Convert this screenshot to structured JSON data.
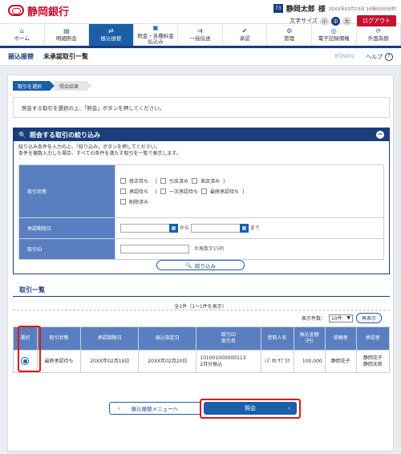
{
  "header": {
    "bank_name": "静岡銀行",
    "user_icon_text": "73",
    "user_name": "静岡太郎",
    "honorific": "様",
    "login_time": "20XX年02月13日 10時00分00秒",
    "font_size_label": "文字サイズ",
    "font_sizes": [
      "小",
      "中",
      "大"
    ],
    "logout": "ログアウト"
  },
  "nav": [
    {
      "icon": "home-icon",
      "glyph": "⌂",
      "label": "ホーム"
    },
    {
      "icon": "statement-icon",
      "glyph": "▤",
      "label": "明細照会"
    },
    {
      "icon": "transfer-icon",
      "glyph": "⇄",
      "label": "振込振替"
    },
    {
      "icon": "tax-icon",
      "glyph": "▣",
      "label": "税金・各種料金\n払込み"
    },
    {
      "icon": "bulk-icon",
      "glyph": "⇉",
      "label": "一括伝送"
    },
    {
      "icon": "approval-icon",
      "glyph": "✔",
      "label": "承認"
    },
    {
      "icon": "manage-icon",
      "glyph": "⚙",
      "label": "管理"
    },
    {
      "icon": "erecord-icon",
      "glyph": "◎",
      "label": "電子記録債権"
    },
    {
      "icon": "forex-icon",
      "glyph": "⟳",
      "label": "外国為替"
    }
  ],
  "title": {
    "main": "振込振替",
    "sub": "未承認取引一覧",
    "screen_id": "BTJS002",
    "help": "ヘルプ"
  },
  "steps": [
    "取引を選択",
    "照会結果"
  ],
  "instruction": "照会する取引を選択の上、「照会」ボタンを押してください。",
  "filter": {
    "title": "照会する取引の絞り込み",
    "desc1": "絞り込み条件を入力の上、「絞り込み」ボタンを押してください。",
    "desc2": "条件を複数入力した場合、すべての条件を満たす取引を一覧で表示します。",
    "status_label": "取引状態",
    "status_row1": [
      "修正待ち",
      "引戻済み",
      "差戻済み"
    ],
    "status_row2": [
      "承認待ち",
      "一次承認待ち",
      "最終承認待ち"
    ],
    "status_row3": [
      "削除済み"
    ],
    "date_label": "承認期限日",
    "date_from": "から",
    "date_to": "まで",
    "id_label": "取引ID",
    "id_hint": "半角数字15桁",
    "button": "絞り込み"
  },
  "list": {
    "title": "取引一覧",
    "count": "全1件（1～1件を表示）",
    "perpage_label": "表示件数：",
    "perpage_value": "10件",
    "redisplay": "再表示",
    "headers": [
      "選択",
      "取引状態",
      "承認期限日",
      "振込指定日",
      "取引ID\n取引名",
      "受取人名",
      "振込金額\n（円）",
      "依頼者",
      "承認者"
    ],
    "row": {
      "status": "最終承認待ち",
      "deadline": "20XX年02月19日",
      "transfer_date": "20XX年02月20日",
      "id": "101001000000113",
      "name": "2月分振込",
      "payee": "ｼｽﾞｵｶ ｻﾌﾞﾛｳ",
      "amount": "100,000",
      "requester": "静岡花子",
      "approver1": "静岡花子",
      "approver2": "静岡太郎"
    }
  },
  "buttons": {
    "back": "振込振替メニューへ",
    "ref": "照会"
  }
}
